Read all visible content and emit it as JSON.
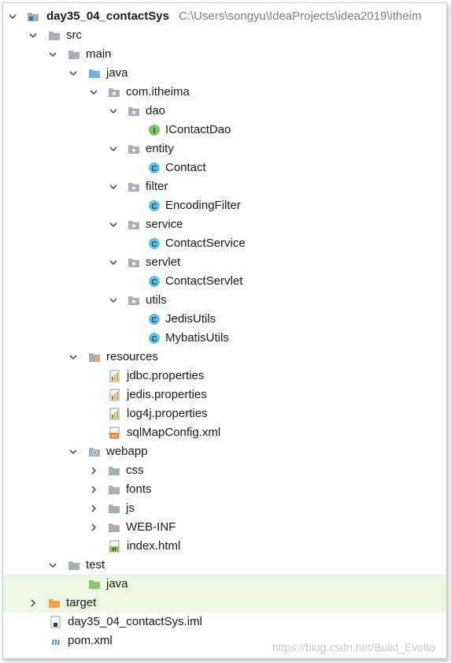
{
  "colors": {
    "folder": "#a9afb6",
    "java_folder": "#6fb3e0",
    "target_folder": "#f0a34a",
    "test_java_folder": "#8ac66a",
    "class_icon": "#63bfe0",
    "interface_icon": "#7dc460",
    "selected_row": "#eef6e4"
  },
  "project": {
    "name": "day35_04_contactSys",
    "path": "C:\\Users\\songyu\\IdeaProjects\\idea2019\\itheim"
  },
  "nodes": [
    {
      "id": "src",
      "label": "src",
      "icon": "folder-icon"
    },
    {
      "id": "main",
      "label": "main",
      "icon": "folder-icon"
    },
    {
      "id": "java",
      "label": "java",
      "icon": "source-folder-icon"
    },
    {
      "id": "pkg",
      "label": "com.itheima",
      "icon": "package-icon"
    },
    {
      "id": "dao",
      "label": "dao",
      "icon": "package-icon"
    },
    {
      "id": "icontactdao",
      "label": "IContactDao",
      "icon": "interface-icon"
    },
    {
      "id": "entity",
      "label": "entity",
      "icon": "package-icon"
    },
    {
      "id": "contact",
      "label": "Contact",
      "icon": "class-icon"
    },
    {
      "id": "filter",
      "label": "filter",
      "icon": "package-icon"
    },
    {
      "id": "encodingfilter",
      "label": "EncodingFilter",
      "icon": "class-icon"
    },
    {
      "id": "service",
      "label": "service",
      "icon": "package-icon"
    },
    {
      "id": "contactservice",
      "label": "ContactService",
      "icon": "class-icon"
    },
    {
      "id": "servlet",
      "label": "servlet",
      "icon": "package-icon"
    },
    {
      "id": "contactservlet",
      "label": "ContactServlet",
      "icon": "class-icon"
    },
    {
      "id": "utils",
      "label": "utils",
      "icon": "package-icon"
    },
    {
      "id": "jedisutils",
      "label": "JedisUtils",
      "icon": "class-icon"
    },
    {
      "id": "mybatisutils",
      "label": "MybatisUtils",
      "icon": "class-icon"
    },
    {
      "id": "resources",
      "label": "resources",
      "icon": "resources-folder-icon"
    },
    {
      "id": "jdbc",
      "label": "jdbc.properties",
      "icon": "properties-file-icon"
    },
    {
      "id": "jedis",
      "label": "jedis.properties",
      "icon": "properties-file-icon"
    },
    {
      "id": "log4j",
      "label": "log4j.properties",
      "icon": "properties-file-icon"
    },
    {
      "id": "sqlmap",
      "label": "sqlMapConfig.xml",
      "icon": "xml-file-icon"
    },
    {
      "id": "webapp",
      "label": "webapp",
      "icon": "web-folder-icon"
    },
    {
      "id": "css",
      "label": "css",
      "icon": "folder-icon"
    },
    {
      "id": "fonts",
      "label": "fonts",
      "icon": "folder-icon"
    },
    {
      "id": "js",
      "label": "js",
      "icon": "folder-icon"
    },
    {
      "id": "webinf",
      "label": "WEB-INF",
      "icon": "folder-icon"
    },
    {
      "id": "index",
      "label": "index.html",
      "icon": "html-file-icon"
    },
    {
      "id": "test",
      "label": "test",
      "icon": "folder-icon"
    },
    {
      "id": "testjava",
      "label": "java",
      "icon": "test-source-folder-icon"
    },
    {
      "id": "target",
      "label": "target",
      "icon": "target-folder-icon"
    },
    {
      "id": "iml",
      "label": "day35_04_contactSys.iml",
      "icon": "iml-file-icon"
    },
    {
      "id": "pom",
      "label": "pom.xml",
      "icon": "maven-icon"
    }
  ],
  "watermark": "https://blog.csdn.net/Bulid_Evolto"
}
